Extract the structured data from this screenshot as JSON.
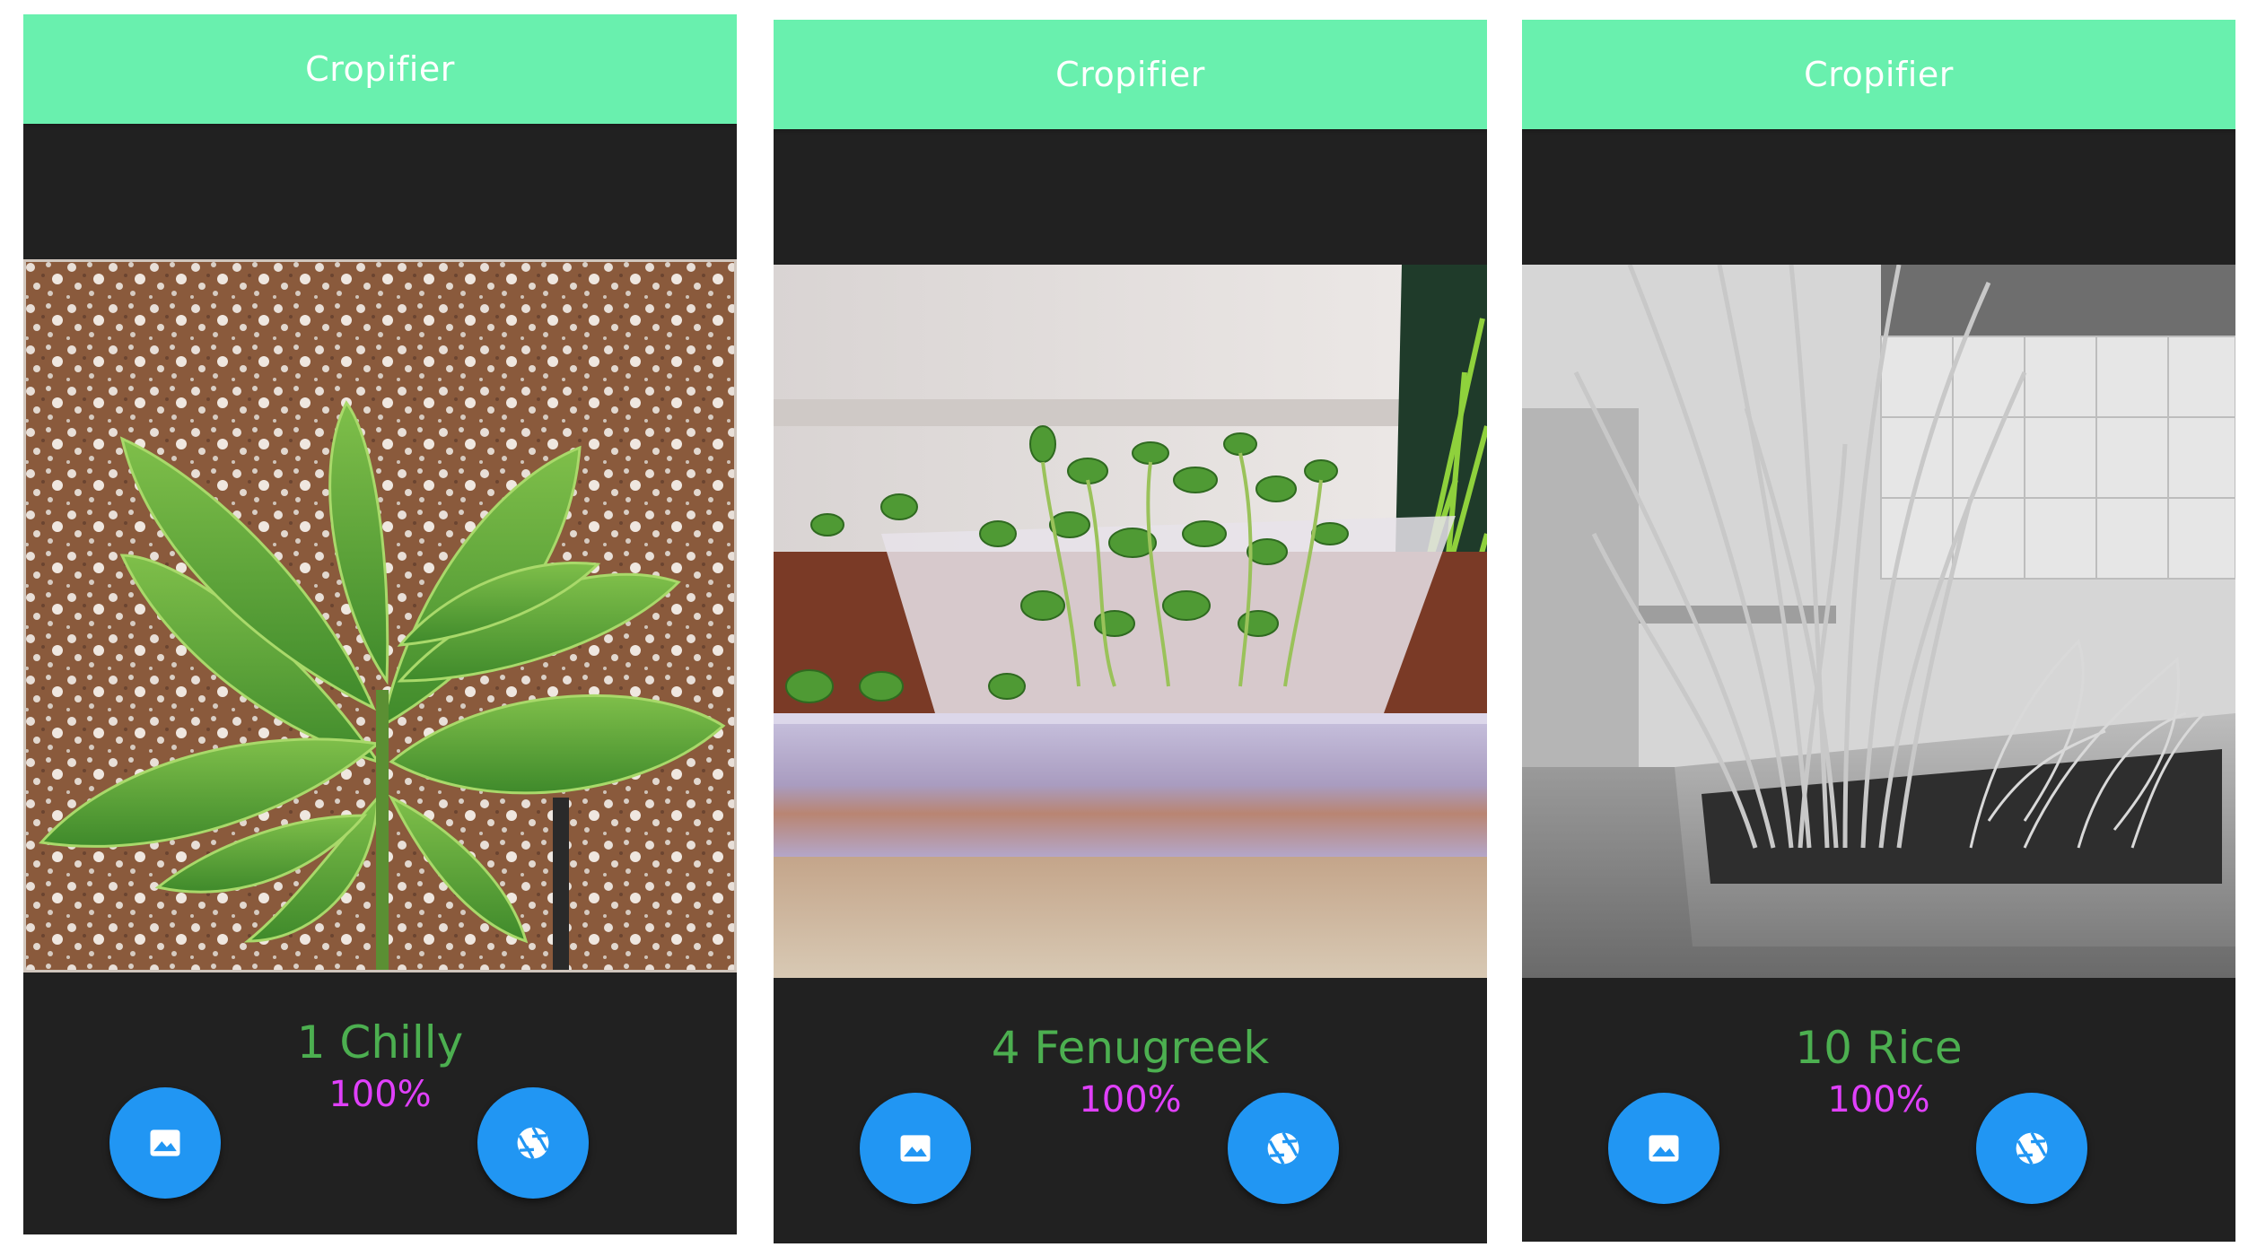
{
  "colors": {
    "appbar": "#69f0ae",
    "background": "#212121",
    "fab": "#2196f3",
    "label": "#4caf50",
    "confidence": "#e040fb"
  },
  "screens": [
    {
      "app_title": "Cropifier",
      "prediction_label": "1 Chilly",
      "confidence": "100%",
      "photo_subject": "chilly-plant-photo",
      "gallery_icon": "image-icon",
      "camera_icon": "camera-shutter-icon"
    },
    {
      "app_title": "Cropifier",
      "prediction_label": "4 Fenugreek",
      "confidence": "100%",
      "photo_subject": "fenugreek-seedlings-photo",
      "gallery_icon": "image-icon",
      "camera_icon": "camera-shutter-icon"
    },
    {
      "app_title": "Cropifier",
      "prediction_label": "10 Rice",
      "confidence": "100%",
      "photo_subject": "rice-seedlings-photo",
      "gallery_icon": "image-icon",
      "camera_icon": "camera-shutter-icon"
    }
  ]
}
